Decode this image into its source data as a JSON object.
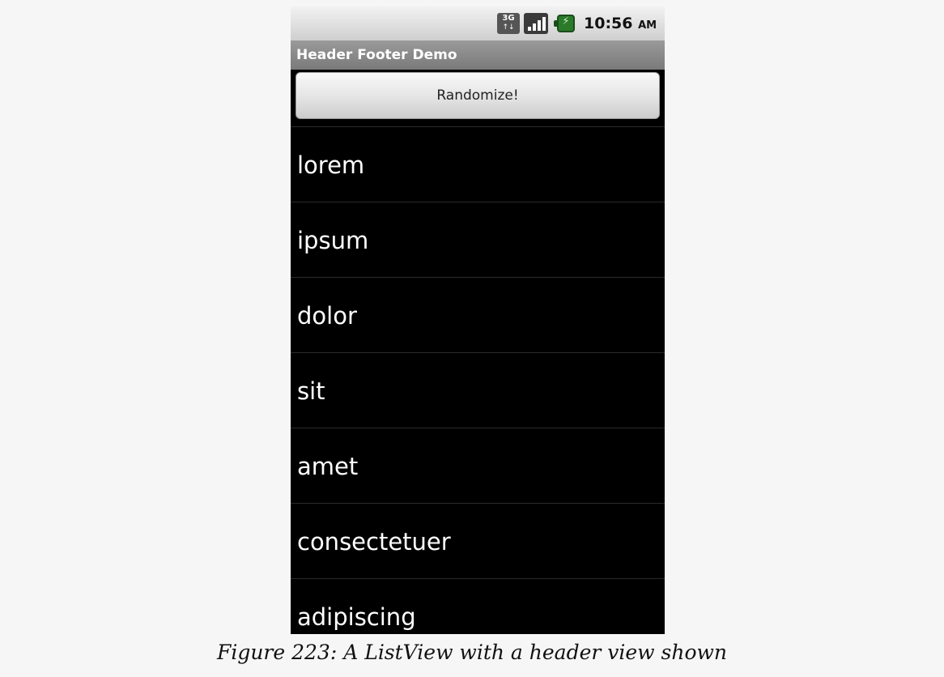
{
  "status_bar": {
    "network_label": "3G",
    "time": "10:56",
    "ampm": "AM"
  },
  "app": {
    "title": "Header Footer Demo"
  },
  "header": {
    "button_label": "Randomize!"
  },
  "list": {
    "items": [
      "lorem",
      "ipsum",
      "dolor",
      "sit",
      "amet",
      "consectetuer",
      "adipiscing"
    ]
  },
  "caption": "Figure 223: A ListView with a header view shown"
}
